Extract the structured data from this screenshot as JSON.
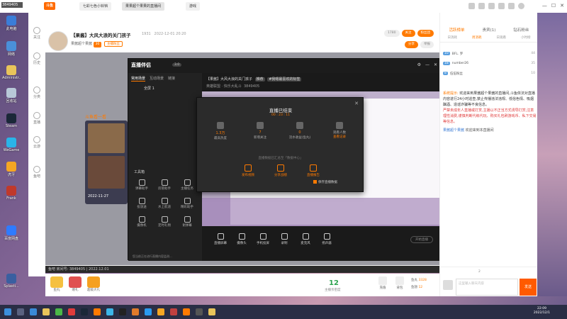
{
  "topbar": {
    "logo": "斗鱼",
    "tabs": [
      "七彩七色小铃铛",
      "果果超个果果的直播间",
      "游戏"
    ],
    "counter": "3849405"
  },
  "desktop_icons": [
    "此电脑",
    "网络",
    "Administr...",
    "回收站",
    "Steam",
    "WeGame",
    "虎牙",
    "Frank",
    "百度网盘",
    "Splasti..."
  ],
  "side_nav": [
    "关注",
    "历史",
    "分类",
    "直播",
    "云游",
    "鱼吧"
  ],
  "room": {
    "title": "【果酱】大风大浪的关门孩子",
    "follow_count": "1931",
    "date": "2022-12-01 20:20",
    "sub": "果酱超个果酱",
    "level_badge": "30",
    "follow_badge": "主播粉丝",
    "btn_count": "1780",
    "btn_follow": "关注",
    "btn_fans": "粉丝团",
    "btn_share": "分享",
    "btn_report": "举报"
  },
  "player": {
    "room_no": "鱼吧 房间号: 3849405 | 2022.12.01",
    "overlay_text": "斗鱼看一看",
    "thumb_date": "2022-11-27"
  },
  "obs": {
    "logo": "直播伴侣",
    "version": "3.0",
    "scene_tabs": [
      "常用场景",
      "互动场景",
      "链接"
    ],
    "scene_name": "全屏 1",
    "title_line": "【果酱】大风大浪的关门孩子",
    "tag1": "推荐",
    "tag2": "#我嗯最喜欢的标签",
    "category": "英雄联盟 · 快乐大乱斗",
    "room_id": "3849405",
    "tools_label": "工具箱",
    "tools": [
      "弹幕助手",
      "房管助手",
      "主播任务",
      "投放送",
      "水上航道",
      "精彩助手",
      "摄像机",
      "定时礼物",
      "谢弹幕"
    ],
    "controls": [
      "直播屏幕",
      "摄像头",
      "手机投屏",
      "录制",
      "麦克风",
      "扬声器"
    ],
    "start_btn": "开始直播",
    "notice": "您当前正在进行直播内容监测..."
  },
  "dialog": {
    "title": "直播已结束",
    "duration": "00 : 23 : 11",
    "stats": [
      {
        "value": "1.3万",
        "label": "最高热度"
      },
      {
        "value": "7",
        "label": "新增关注"
      },
      {
        "value": "0",
        "label": "流水收益(鱼丸)"
      },
      {
        "value": "",
        "label": "观看人数",
        "link": "查看记录"
      }
    ],
    "note": "直播数据已汇总至「数据中心」",
    "actions": [
      "发布视频",
      "分享战绩",
      "直播报告"
    ],
    "checkbox": "保存直播数据"
  },
  "gift_bar": {
    "gifts": [
      "鱼丸",
      "赠礼",
      "超级大礼"
    ],
    "number": "12",
    "number_label": "主播亲密度",
    "items": [
      "充值",
      "背包"
    ],
    "fish_label": "鱼丸",
    "fish_value": "3328",
    "fin_label": "鱼翅",
    "fin_value": "12"
  },
  "chat": {
    "tabs": [
      "活跃榜单",
      "贵宾(1)",
      "钻石粉丝"
    ],
    "subtabs": [
      "日消耗",
      "周消耗",
      "日观看",
      "小时榜"
    ],
    "ranks": [
      {
        "lv": "10",
        "name": "BFL. 罗",
        "val": "44"
      },
      {
        "lv": "18",
        "name": "number26",
        "val": "35"
      },
      {
        "lv": "8",
        "name": "伍伍粉丝",
        "val": "10"
      }
    ],
    "system_label": "系统提示:",
    "system_msg": "欢迎来到果酱超个果酱的直播间,斗鱼依法对直播内容进行24小时巡查,禁止传播违法违规、低俗色情、吸烟酗酒、造谣诈骗等不良信息。",
    "warning": "严禁未成年人直播或打赏,主播以不正当方式诱导打赏,注意理性消费,谨慎判断代练代玩、购买礼包刷游戏币、私下交易等信息。",
    "welcome_name": "果酱超个果酱",
    "welcome_text": "欢迎来到本直播间",
    "input_placeholder": "这里输入聊天内容",
    "send": "发送",
    "fish_count": "2"
  },
  "clock": {
    "time": "22:09",
    "date": "2022/12/1"
  }
}
